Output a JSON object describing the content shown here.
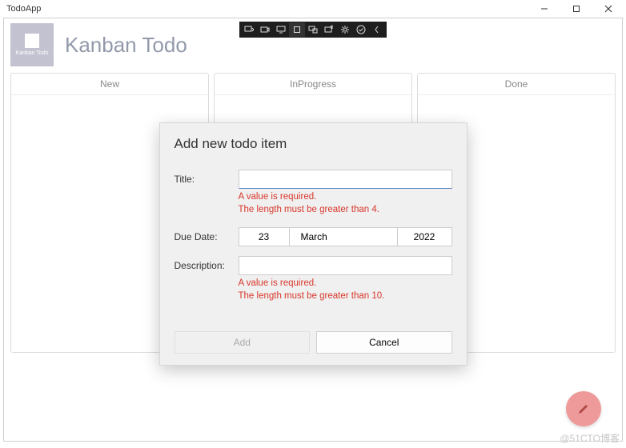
{
  "window": {
    "title": "TodoApp"
  },
  "app": {
    "title": "Kanban Todo",
    "logo_label": "Kanban Todo"
  },
  "columns": [
    {
      "label": "New"
    },
    {
      "label": "InProgress"
    },
    {
      "label": "Done"
    }
  ],
  "dialog": {
    "title": "Add new todo item",
    "title_label": "Title:",
    "title_value": "",
    "title_error1": "A value is required.",
    "title_error2": "The length must be greater than 4.",
    "due_label": "Due Date:",
    "due_day": "23",
    "due_month": "March",
    "due_year": "2022",
    "desc_label": "Description:",
    "desc_value": "",
    "desc_error1": "A value is required.",
    "desc_error2": "The length must be greater than 10.",
    "add_button": "Add",
    "cancel_button": "Cancel"
  },
  "debug_icons": [
    "preview-icon",
    "camera-icon",
    "monitor-icon",
    "square-icon",
    "devices-icon",
    "share-icon",
    "gear-icon",
    "check-icon",
    "chevron-left-icon"
  ],
  "watermark": "@51CTO博客"
}
